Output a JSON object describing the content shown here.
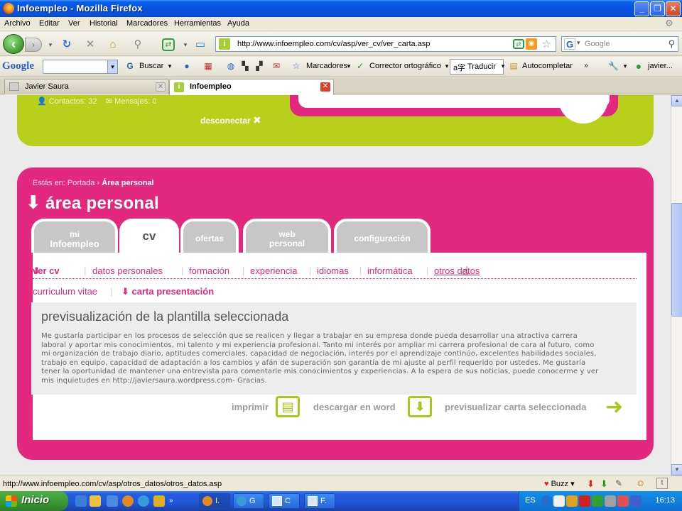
{
  "window": {
    "title": "Infoempleo - Mozilla Firefox"
  },
  "menu": [
    "Archivo",
    "Editar",
    "Ver",
    "Historial",
    "Marcadores",
    "Herramientas",
    "Ayuda"
  ],
  "nav": {
    "url": "http://www.infoempleo.com/cv/asp/ver_cv/ver_carta.asp",
    "search_placeholder": "Google"
  },
  "google_toolbar": {
    "logo": "Google",
    "buscar": "Buscar",
    "marcadores": "Marcadores",
    "corrector": "Corrector ortográfico",
    "traducir": "Traducir",
    "autocompletar": "Autocompletar",
    "user": "javier..."
  },
  "tabs": [
    {
      "label": "Javier Saura",
      "active": false
    },
    {
      "label": "Infoempleo",
      "active": true
    }
  ],
  "page": {
    "contacts": "Contactos: 32",
    "messages": "Mensajes: 0",
    "disconnect": "desconectar",
    "breadcrumb_prefix": "Estás en: Portada",
    "breadcrumb_sep": "›",
    "breadcrumb_current": "Área personal",
    "section_title": "área personal",
    "tabs": {
      "mi_infoempleo_1": "mi",
      "mi_infoempleo_2": "Infoempleo",
      "cv": "cv",
      "ofertas": "ofertas",
      "web_1": "web",
      "web_2": "personal",
      "configuracion": "configuración"
    },
    "subnav": [
      "ver cv",
      "datos personales",
      "formación",
      "experiencia",
      "idiomas",
      "informática",
      "otros datos"
    ],
    "subnav2": [
      "curriculum vitae",
      "carta presentación"
    ],
    "preview_title": "previsualización de la plantilla seleccionada",
    "preview_lines": [
      "Me gustaría participar en los procesos de selección que se realicen y llegar a trabajar en su empresa donde pueda desarrollar una atractiva carrera",
      "laboral y aportar mis conocimientos, mi talento y mi experiencia profesional. Tanto mi interés por ampliar mi carrera profesional de cara al futuro, como",
      "mi organización de trabajo diario, aptitudes comerciales, capacidad de negociación, interés por el aprendizaje continúo, excelentes habilidades sociales,",
      "trabajo en equipo, capacidad de adaptación a los cambios y afán de superación son garantía de mi ajuste al perfil requerido por ustedes. Me gustaría",
      "tener la oportunidad de mantener una entrevista para comentarle mis conocimientos y experiencias. A la espera de sus noticias, puede conocerme y ver",
      "mis inquietudes en http://javiersaura.wordpress.com- Gracias."
    ],
    "actions": {
      "print": "imprimir",
      "download": "descargar en word",
      "preview": "previsualizar carta seleccionada"
    }
  },
  "status": {
    "text": "http://www.infoempleo.com/cv/asp/otros_datos/otros_datos.asp",
    "buzz": "Buzz"
  },
  "taskbar": {
    "start": "Inicio",
    "tasks": [
      "I.",
      "G",
      "C",
      "F."
    ],
    "lang": "ES",
    "clock": "16:13"
  },
  "colors": {
    "pink": "#E3287F",
    "green": "#B8CF1B",
    "action_green": "#A8C71A"
  }
}
